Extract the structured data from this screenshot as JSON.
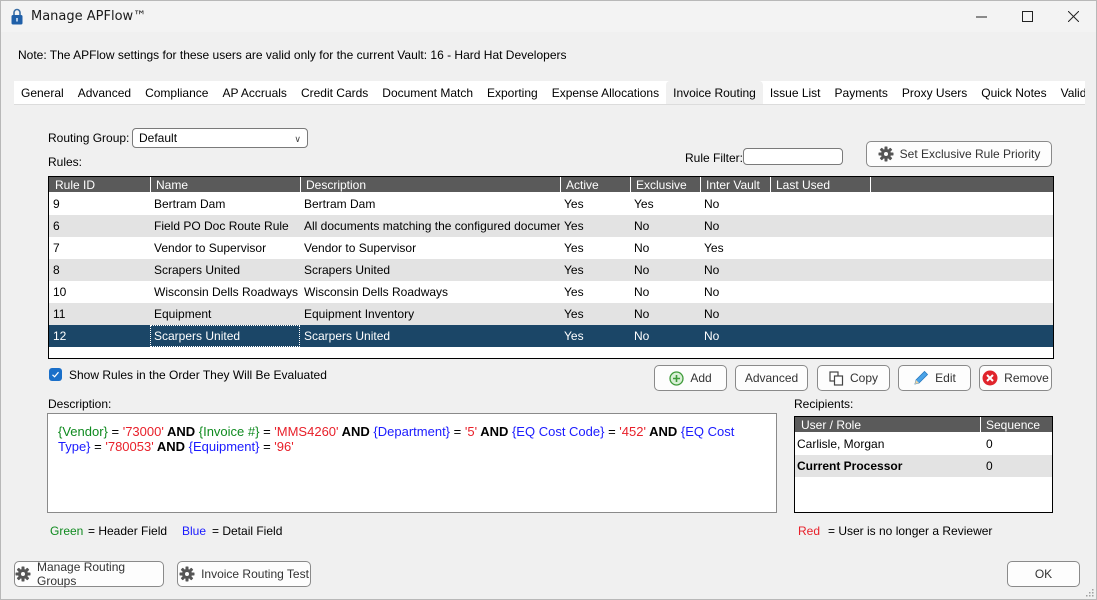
{
  "window": {
    "title": "Manage APFlow™",
    "icon": "lock-icon",
    "controls": [
      "minimize",
      "maximize",
      "close"
    ]
  },
  "note": "Note:  The APFlow settings for these users are valid only for the current Vault: 16 - Hard Hat Developers",
  "tabs": [
    {
      "label": "General",
      "active": false
    },
    {
      "label": "Advanced",
      "active": false
    },
    {
      "label": "Compliance",
      "active": false
    },
    {
      "label": "AP Accruals",
      "active": false
    },
    {
      "label": "Credit Cards",
      "active": false
    },
    {
      "label": "Document Match",
      "active": false
    },
    {
      "label": "Exporting",
      "active": false
    },
    {
      "label": "Expense Allocations",
      "active": false
    },
    {
      "label": "Invoice Routing",
      "active": true
    },
    {
      "label": "Issue List",
      "active": false
    },
    {
      "label": "Payments",
      "active": false
    },
    {
      "label": "Proxy Users",
      "active": false
    },
    {
      "label": "Quick Notes",
      "active": false
    },
    {
      "label": "Validation",
      "active": false
    }
  ],
  "routing_group": {
    "label": "Routing Group:",
    "value": "Default"
  },
  "rules_label": "Rules:",
  "rule_filter": {
    "label": "Rule Filter:",
    "value": "",
    "placeholder": ""
  },
  "set_exclusive_button": "Set Exclusive Rule Priority",
  "rules_table": {
    "columns": [
      "Rule ID",
      "Name",
      "Description",
      "Active",
      "Exclusive",
      "Inter Vault",
      "Last Used"
    ],
    "rows": [
      {
        "id": "9",
        "name": "Bertram Dam",
        "description": "Bertram Dam",
        "active": "Yes",
        "exclusive": "Yes",
        "inter_vault": "No",
        "last_used": ""
      },
      {
        "id": "6",
        "name": "Field PO Doc Route Rule",
        "description": "All documents matching the configured document ty...",
        "active": "Yes",
        "exclusive": "No",
        "inter_vault": "No",
        "last_used": ""
      },
      {
        "id": "7",
        "name": "Vendor to Supervisor",
        "description": "Vendor to Supervisor",
        "active": "Yes",
        "exclusive": "No",
        "inter_vault": "Yes",
        "last_used": ""
      },
      {
        "id": "8",
        "name": "Scrapers United",
        "description": "Scrapers United",
        "active": "Yes",
        "exclusive": "No",
        "inter_vault": "No",
        "last_used": ""
      },
      {
        "id": "10",
        "name": "Wisconsin Dells Roadways",
        "description": "Wisconsin Dells Roadways",
        "active": "Yes",
        "exclusive": "No",
        "inter_vault": "No",
        "last_used": ""
      },
      {
        "id": "11",
        "name": "Equipment",
        "description": "Equipment Inventory",
        "active": "Yes",
        "exclusive": "No",
        "inter_vault": "No",
        "last_used": ""
      },
      {
        "id": "12",
        "name": "Scarpers United",
        "description": "Scarpers United",
        "active": "Yes",
        "exclusive": "No",
        "inter_vault": "No",
        "last_used": "",
        "selected": true
      }
    ]
  },
  "show_order_checkbox": {
    "label": "Show Rules in the Order They Will Be Evaluated",
    "checked": true
  },
  "actions": {
    "add": "Add",
    "advanced": "Advanced",
    "copy": "Copy",
    "edit": "Edit",
    "remove": "Remove"
  },
  "description": {
    "label": "Description:",
    "tokens": [
      {
        "text": "{Vendor}",
        "kind": "header"
      },
      {
        "text": " = ",
        "kind": "op"
      },
      {
        "text": "'73000'",
        "kind": "value"
      },
      {
        "text": " AND ",
        "kind": "keyword"
      },
      {
        "text": "{Invoice #}",
        "kind": "header"
      },
      {
        "text": " = ",
        "kind": "op"
      },
      {
        "text": "'MMS4260'",
        "kind": "value"
      },
      {
        "text": " AND ",
        "kind": "keyword"
      },
      {
        "text": "{Department}",
        "kind": "detail"
      },
      {
        "text": " = ",
        "kind": "op"
      },
      {
        "text": "'5'",
        "kind": "value"
      },
      {
        "text": " AND ",
        "kind": "keyword"
      },
      {
        "text": "{EQ Cost Code}",
        "kind": "detail"
      },
      {
        "text": " = ",
        "kind": "op"
      },
      {
        "text": "'452'",
        "kind": "value"
      },
      {
        "text": " AND ",
        "kind": "keyword"
      },
      {
        "text": "{EQ Cost Type}",
        "kind": "detail"
      },
      {
        "text": " = ",
        "kind": "op"
      },
      {
        "text": "'780053'",
        "kind": "value"
      },
      {
        "text": " AND ",
        "kind": "keyword"
      },
      {
        "text": "{Equipment}",
        "kind": "detail"
      },
      {
        "text": " = ",
        "kind": "op"
      },
      {
        "text": "'96'",
        "kind": "value"
      }
    ]
  },
  "recipients": {
    "label": "Recipients:",
    "columns": [
      "User / Role",
      "Sequence"
    ],
    "rows": [
      {
        "user": "Carlisle, Morgan",
        "sequence": "0",
        "bold": false
      },
      {
        "user": "Current Processor",
        "sequence": "0",
        "bold": true
      }
    ]
  },
  "legend": {
    "green_word": "Green",
    "green_desc": "=  Header Field",
    "blue_word": "Blue",
    "blue_desc": "=  Detail Field",
    "red_word": "Red",
    "red_desc": "=  User is no longer a Reviewer"
  },
  "colors": {
    "header_field": "#0f8a1f",
    "detail_field": "#1a1aff",
    "value": "#e8202a",
    "selected_row": "#1b4667",
    "grid_header": "#5a5a5a",
    "checkbox": "#1a6fc9"
  },
  "footer": {
    "manage_groups": "Manage Routing Groups",
    "routing_test": "Invoice Routing Test",
    "ok": "OK"
  }
}
